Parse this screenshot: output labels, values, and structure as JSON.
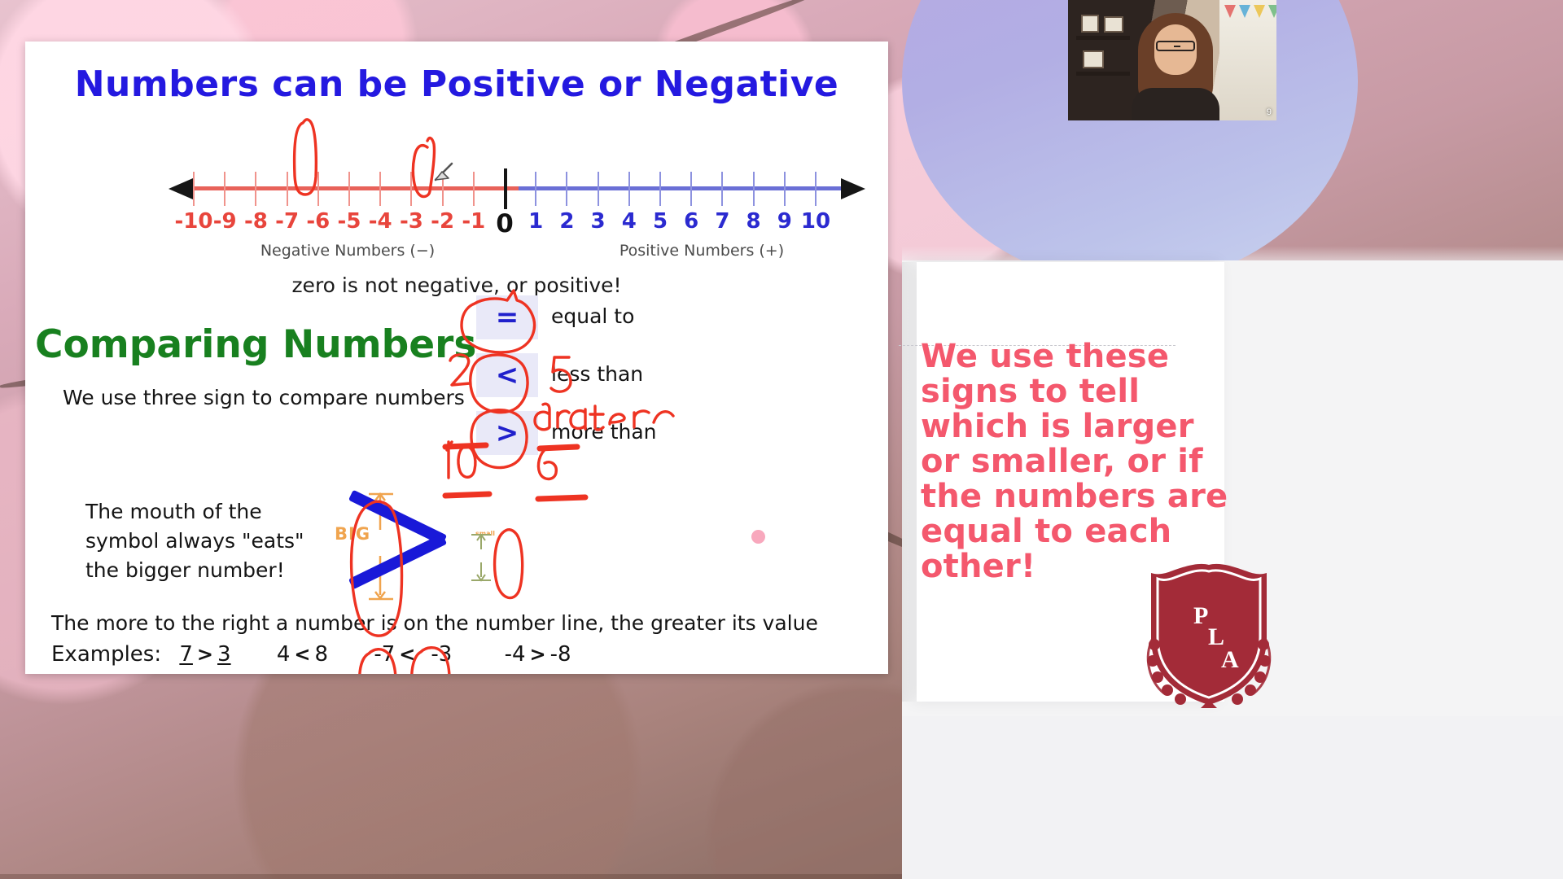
{
  "slide": {
    "title": "Numbers can be Positive or Negative",
    "number_line": {
      "negative_labels": [
        "-10",
        "-9",
        "-8",
        "-7",
        "-6",
        "-5",
        "-4",
        "-3",
        "-2",
        "-1"
      ],
      "zero_label": "0",
      "positive_labels": [
        "1",
        "2",
        "3",
        "4",
        "5",
        "6",
        "7",
        "8",
        "9",
        "10"
      ],
      "left_caption": "Negative Numbers (−)",
      "right_caption": "Positive Numbers (+)",
      "negative_color": "#e8453c",
      "positive_color": "#2b2ad0"
    },
    "zero_note": "zero is not negative, or positive!",
    "section_title": "Comparing Numbers",
    "section_subtitle": "We use three sign to compare numbers",
    "signs": [
      {
        "symbol": "=",
        "label": "equal to"
      },
      {
        "symbol": "<",
        "label": "less than"
      },
      {
        "symbol": ">",
        "label": "more than"
      }
    ],
    "mouth_note": "The mouth of the symbol always \"eats\" the bigger number!",
    "big_label": "BIG",
    "small_label": "small",
    "rule_line": "The more to the right a number is on the number line, the greater its value",
    "examples_label": "Examples:",
    "examples": [
      {
        "left": "7",
        "op": ">",
        "right": "3"
      },
      {
        "left": "4",
        "op": "<",
        "right": "8"
      },
      {
        "left": "-7",
        "op": "<",
        "right": "-3"
      },
      {
        "left": "-4",
        "op": ">",
        "right": "-8"
      }
    ]
  },
  "annotations": {
    "ink_color": "#ee3322",
    "handwritten": [
      {
        "text": "2",
        "note": "written left of the less-than sign"
      },
      {
        "text": "5",
        "note": "written right of the less-than sign"
      },
      {
        "text": "10",
        "note": "written left of the more-than sign"
      },
      {
        "text": "6",
        "note": "written right of the more-than sign"
      },
      {
        "text": "greater",
        "note": "written above 'more than'"
      }
    ],
    "circled": [
      "-7",
      "-3",
      "=",
      "<",
      ">",
      "BIG",
      "small"
    ]
  },
  "notes_panel": {
    "text": "We use these signs to tell which is larger or smaller, or if the numbers are equal to each other!",
    "color": "#f4586d"
  },
  "logo": {
    "letters": [
      "P",
      "L",
      "A"
    ],
    "color": "#a32b38"
  },
  "webcam": {
    "page_number": "9"
  }
}
